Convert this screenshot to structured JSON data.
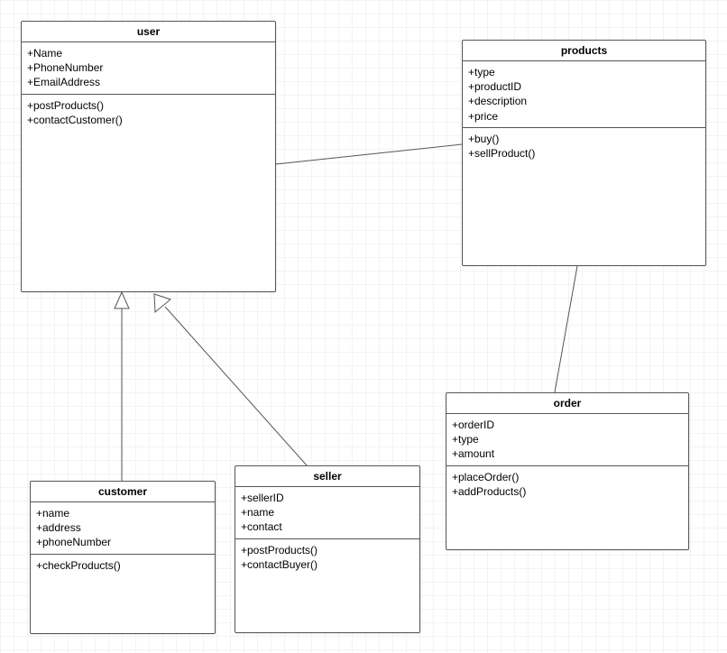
{
  "classes": {
    "user": {
      "name": "user",
      "attributes": [
        "+Name",
        "+PhoneNumber",
        "+EmailAddress"
      ],
      "methods": [
        "+postProducts()",
        "+contactCustomer()"
      ]
    },
    "products": {
      "name": "products",
      "attributes": [
        "+type",
        "+productID",
        "+description",
        "+price"
      ],
      "methods": [
        "+buy()",
        "+sellProduct()"
      ]
    },
    "customer": {
      "name": "customer",
      "attributes": [
        "+name",
        "+address",
        "+phoneNumber"
      ],
      "methods": [
        "+checkProducts()"
      ]
    },
    "seller": {
      "name": "seller",
      "attributes": [
        "+sellerID",
        "+name",
        "+contact"
      ],
      "methods": [
        "+postProducts()",
        "+contactBuyer()"
      ]
    },
    "order": {
      "name": "order",
      "attributes": [
        "+orderID",
        "+type",
        "+amount"
      ],
      "methods": [
        "+placeOrder()",
        "+addProducts()"
      ]
    }
  },
  "relationships": [
    {
      "from": "user",
      "to": "products",
      "type": "association"
    },
    {
      "from": "products",
      "to": "order",
      "type": "association"
    },
    {
      "from": "customer",
      "to": "user",
      "type": "generalization"
    },
    {
      "from": "seller",
      "to": "user",
      "type": "generalization"
    }
  ]
}
